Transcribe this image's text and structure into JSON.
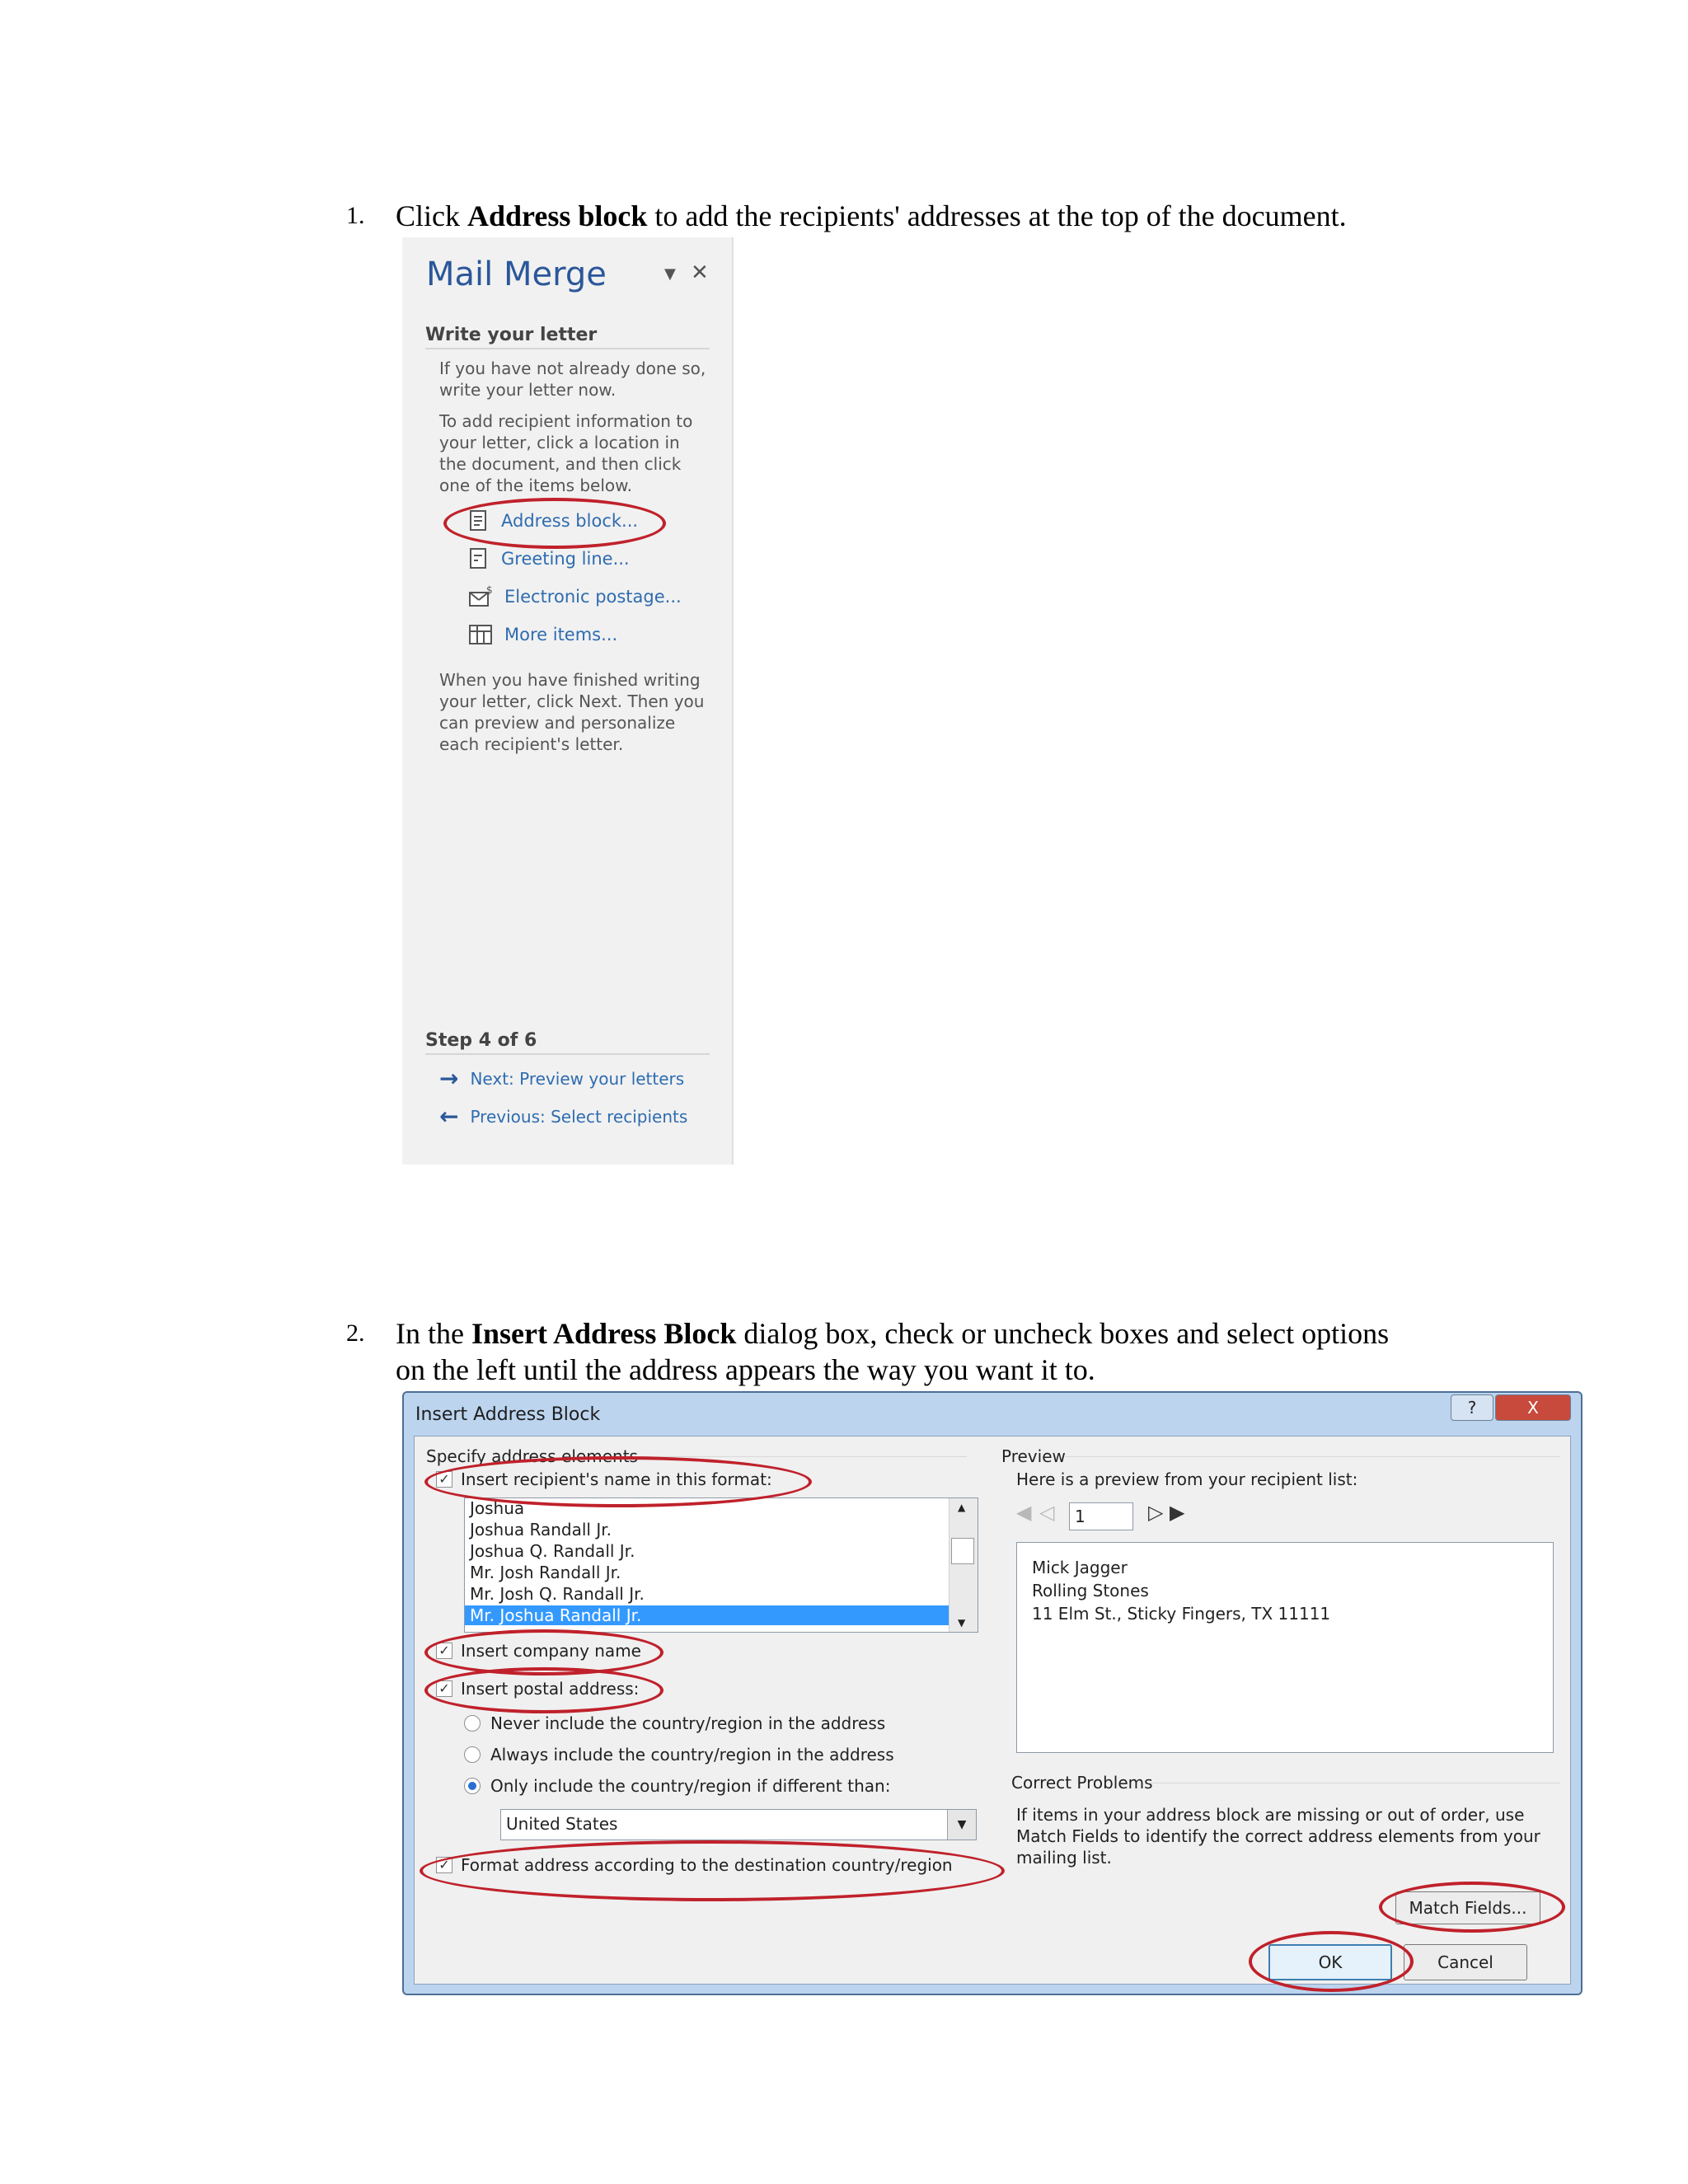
{
  "step1": {
    "num": "1.",
    "pre": "Click ",
    "bold": "Address block",
    "post": " to add the recipients' addresses at the top of the document."
  },
  "mail_merge": {
    "title": "Mail Merge",
    "menu_icon": "dropdown-arrow-icon",
    "close_icon": "close-icon",
    "section": "Write your letter",
    "para1": "If you have not already done so, write your letter now.",
    "para2": "To add recipient information to your letter, click a location in the document, and then click one of the items below.",
    "links": [
      {
        "label": "Address block...",
        "icon": "address-block-icon"
      },
      {
        "label": "Greeting line...",
        "icon": "greeting-line-icon"
      },
      {
        "label": "Electronic postage...",
        "icon": "electronic-postage-icon"
      },
      {
        "label": "More items...",
        "icon": "more-items-icon"
      }
    ],
    "para3": "When you have finished writing your letter, click Next. Then you can preview and personalize each recipient's letter.",
    "step": "Step 4 of 6",
    "next": "Next: Preview your letters",
    "previous": "Previous: Select recipients",
    "accent": "#2b579a",
    "highlight": "#c0212b"
  },
  "step2": {
    "num": "2.",
    "pre": "In the ",
    "bold": "Insert Address Block",
    "post": " dialog box, check or uncheck boxes and select options",
    "line2": "on the left until the address appears the way you want it to."
  },
  "dialog": {
    "title": "Insert Address Block",
    "help": "?",
    "close": "X",
    "specify_label": "Specify address elements",
    "insert_name": {
      "label": "Insert recipient's name in this format:",
      "checked": true
    },
    "name_formats": [
      "Joshua",
      "Joshua Randall Jr.",
      "Joshua Q. Randall Jr.",
      "Mr. Josh Randall Jr.",
      "Mr. Josh Q. Randall Jr.",
      "Mr. Joshua Randall Jr."
    ],
    "selected_format": "Mr. Joshua Randall Jr.",
    "insert_company": {
      "label": "Insert company name",
      "checked": true
    },
    "insert_postal": {
      "label": "Insert postal address:",
      "checked": true
    },
    "country_options": [
      {
        "label": "Never include the country/region in the address",
        "selected": false
      },
      {
        "label": "Always include the country/region in the address",
        "selected": false
      },
      {
        "label": "Only include the country/region if different than:",
        "selected": true
      }
    ],
    "country_value": "United States",
    "format_destination": {
      "label": "Format address according to the destination country/region",
      "checked": true
    },
    "preview_label": "Preview",
    "preview_intro": "Here is a preview from your recipient list:",
    "record_number": "1",
    "preview_lines": [
      "Mick Jagger",
      "Rolling Stones",
      "11 Elm St., Sticky Fingers, TX 11111"
    ],
    "correct_label": "Correct Problems",
    "correct_text": "If items in your address block are missing or out of order, use Match Fields to identify the correct address elements from your mailing list.",
    "match_fields": "Match Fields...",
    "ok": "OK",
    "cancel": "Cancel",
    "selection_color": "#3399ff"
  }
}
